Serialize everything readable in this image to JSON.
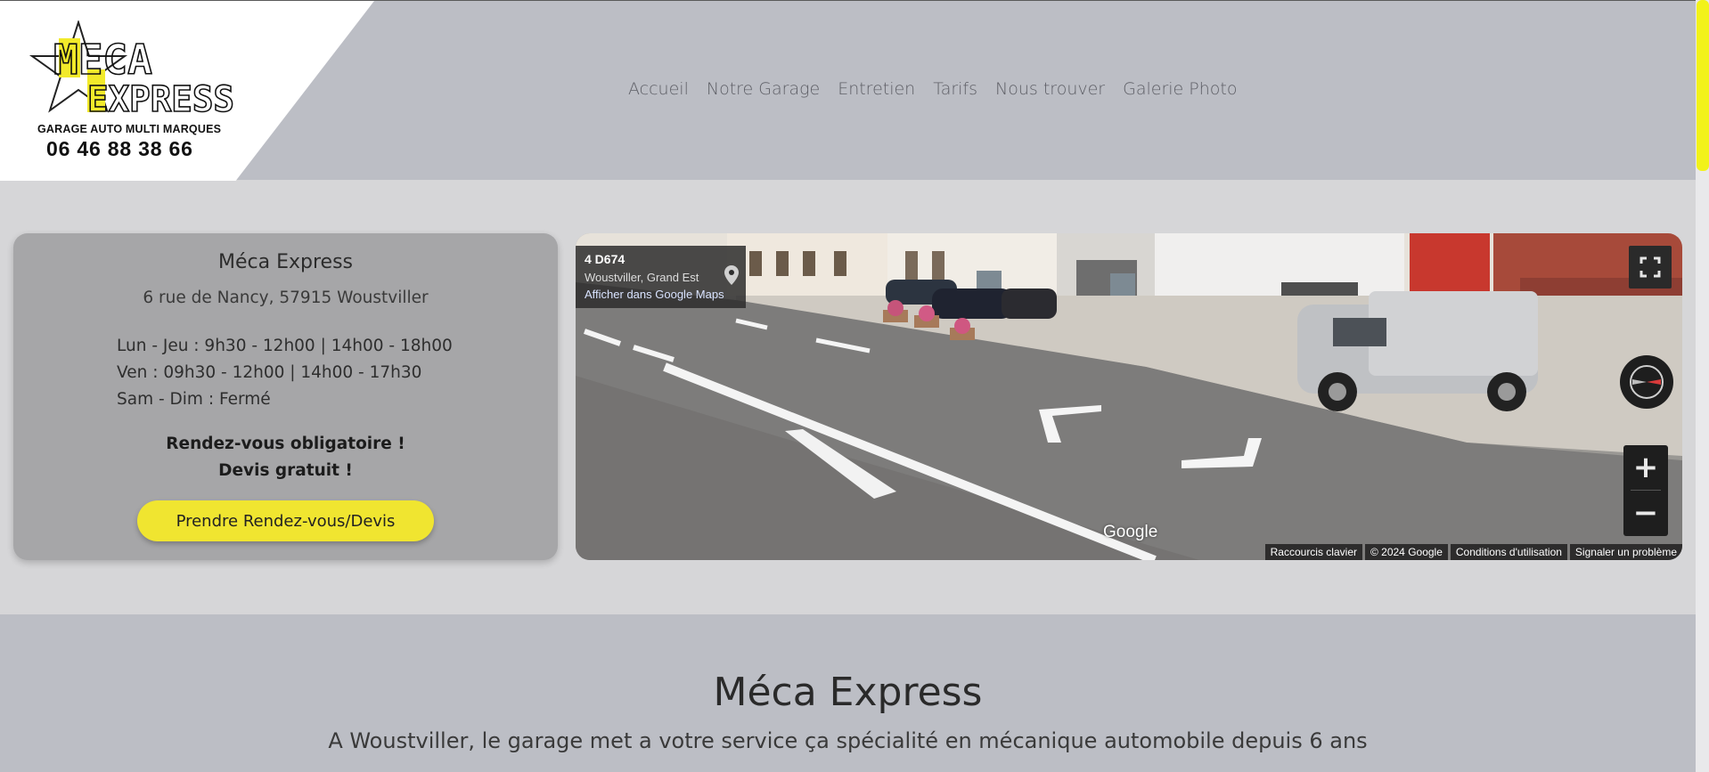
{
  "brand": {
    "logo_line1": "MECA",
    "logo_line2": "EXPRESS",
    "tagline": "GARAGE AUTO MULTI MARQUES",
    "phone": "06 46 88 38 66"
  },
  "nav": {
    "items": [
      "Accueil",
      "Notre Garage",
      "Entretien",
      "Tarifs",
      "Nous trouver",
      "Galerie Photo"
    ]
  },
  "info_card": {
    "title": "Méca Express",
    "address": "6 rue de Nancy, 57915 Woustviller",
    "hours": [
      "Lun - Jeu : 9h30 - 12h00 | 14h00 - 18h00",
      "Ven : 09h30 - 12h00 | 14h00 - 17h30",
      "Sam - Dim : Fermé"
    ],
    "notice_line1": "Rendez-vous obligatoire !",
    "notice_line2": "Devis gratuit !",
    "cta_label": "Prendre Rendez-vous/Devis"
  },
  "streetview": {
    "road": "4 D674",
    "region": "Woustviller, Grand Est",
    "maps_link": "Afficher dans Google Maps",
    "google_label": "Google",
    "footer": [
      "Raccourcis clavier",
      "© 2024 Google",
      "Conditions d'utilisation",
      "Signaler un problème"
    ],
    "zoom_in": "+",
    "zoom_out": "−",
    "icons": [
      "location-pin-icon",
      "fullscreen-icon",
      "compass-icon"
    ]
  },
  "section": {
    "title": "Méca Express",
    "subtitle": "A Woustviller, le garage met a votre service ça spécialité en mécanique automobile depuis 6 ans"
  },
  "colors": {
    "header_bg": "#bcbec5",
    "accent_yellow": "#f0e530",
    "card_bg": "#a6a6a8",
    "page_bg": "#d6d6d8"
  }
}
